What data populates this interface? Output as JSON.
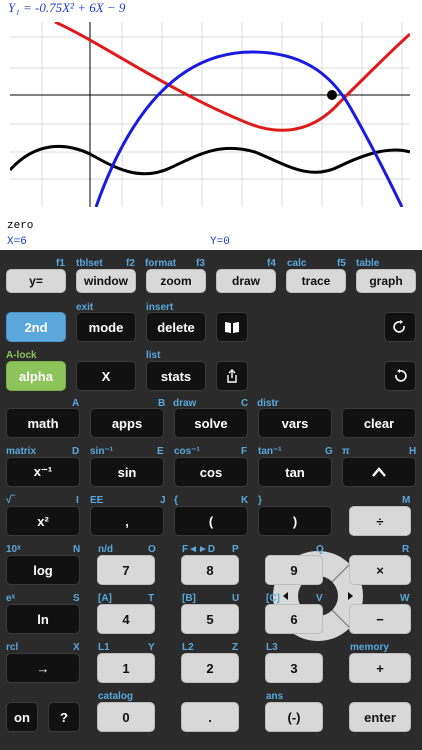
{
  "screen": {
    "equation": "Y₁ = -0.75X² + 6X − 9",
    "mode_label": "zero",
    "x_readout": "X=6",
    "y_readout": "Y=0"
  },
  "colors": {
    "blue_curve": "#1a1ae0",
    "red_curve": "#e01a1a",
    "black_curve": "#000000",
    "label_blue": "#5aa7dc",
    "label_green": "#8cc35a"
  },
  "keys": {
    "r1": [
      "y=",
      "window",
      "zoom",
      "draw",
      "trace",
      "graph"
    ],
    "r1_top": [
      "f1",
      "tblset",
      "f2",
      "format",
      "f3",
      "f4",
      "calc",
      "f5",
      "table"
    ],
    "second": "2nd",
    "mode": "mode",
    "delete": "delete",
    "exit": "exit",
    "insert": "insert",
    "alpha": "alpha",
    "x": "X",
    "stats": "stats",
    "alock": "A-lock",
    "list": "list",
    "math": "math",
    "apps": "apps",
    "solve": "solve",
    "vars": "vars",
    "clear": "clear",
    "row_math_top": [
      "A",
      "B",
      "draw",
      "C",
      "distr"
    ],
    "xinv": "x⁻¹",
    "sin": "sin",
    "cos": "cos",
    "tan": "tan",
    "row_trig_top": [
      "matrix",
      "D",
      "sin⁻¹",
      "E",
      "cos⁻¹",
      "F",
      "tan⁻¹",
      "G",
      "π",
      "H"
    ],
    "xsq": "x²",
    "comma": ",",
    "lparen": "(",
    "rparen": ")",
    "div": "÷",
    "row_sq_top": [
      "√‾",
      "I",
      "EE",
      "J",
      "{",
      "K",
      "}",
      "M"
    ],
    "log": "log",
    "n7": "7",
    "n8": "8",
    "n9": "9",
    "mul": "×",
    "row_log_top": [
      "10ˣ",
      "N",
      "n/d",
      "O",
      "F◄►D",
      "P",
      "Q",
      "R"
    ],
    "ln": "ln",
    "n4": "4",
    "n5": "5",
    "n6": "6",
    "minus": "−",
    "row_ln_top": [
      "eˣ",
      "S",
      "[A]",
      "T",
      "[B]",
      "U",
      "[C]",
      "V",
      "W"
    ],
    "sto": "→",
    "n1": "1",
    "n2": "2",
    "n3": "3",
    "plus": "+",
    "row_sto_top": [
      "rcl",
      "X",
      "L1",
      "Y",
      "L2",
      "Z",
      "L3",
      "memory"
    ],
    "on": "on",
    "help": "?",
    "n0": "0",
    "dot": ".",
    "neg": "(-)",
    "enter": "enter",
    "row_on_top": [
      "catalog",
      "ans"
    ]
  }
}
